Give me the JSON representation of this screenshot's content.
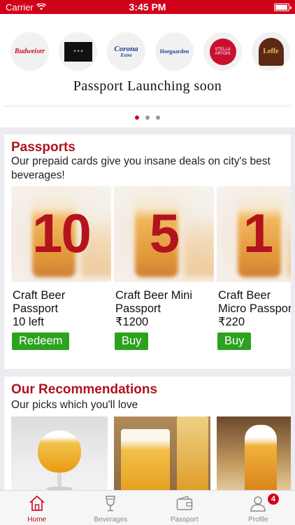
{
  "status_bar": {
    "carrier": "Carrier",
    "time": "3:45 PM",
    "battery_level": 0.95
  },
  "brands": {
    "logos": [
      {
        "name": "Budweiser",
        "icon": "budweiser-logo"
      },
      {
        "name": "",
        "icon": "dark-label-logo"
      },
      {
        "name": "Corona",
        "sub": "Extra",
        "icon": "corona-logo"
      },
      {
        "name": "Hoegaarden",
        "icon": "hoegaarden-logo"
      },
      {
        "name": "STELLA ARTOIS",
        "icon": "stella-artois-logo"
      },
      {
        "name": "Leffe",
        "icon": "leffe-logo"
      }
    ],
    "caption": "Passport Launching soon",
    "page_count": 3,
    "active_page": 1
  },
  "passports": {
    "title": "Passports",
    "subtitle": "Our prepaid cards give you insane deals on city's best beverages!",
    "items": [
      {
        "number": "10",
        "name": "Craft Beer Passport",
        "detail": "10 left",
        "button": "Redeem"
      },
      {
        "number": "5",
        "name": "Craft Beer Mini Passport",
        "detail": "₹1200",
        "button": "Buy"
      },
      {
        "number": "1",
        "name": "Craft Beer Micro Passport",
        "detail": "₹220",
        "button": "Buy"
      }
    ]
  },
  "recommendations": {
    "title": "Our Recommendations",
    "subtitle": "Our picks which you'll love"
  },
  "tab_bar": {
    "tabs": [
      {
        "label": "Home",
        "icon": "home-icon",
        "active": true
      },
      {
        "label": "Beverages",
        "icon": "wine-glass-icon",
        "active": false
      },
      {
        "label": "Passport",
        "icon": "wallet-icon",
        "active": false
      },
      {
        "label": "Profile",
        "icon": "profile-icon",
        "active": false,
        "badge": "4"
      }
    ]
  },
  "colors": {
    "brand_red": "#d0021b",
    "title_red": "#b0121e",
    "button_green": "#2ca21f"
  }
}
